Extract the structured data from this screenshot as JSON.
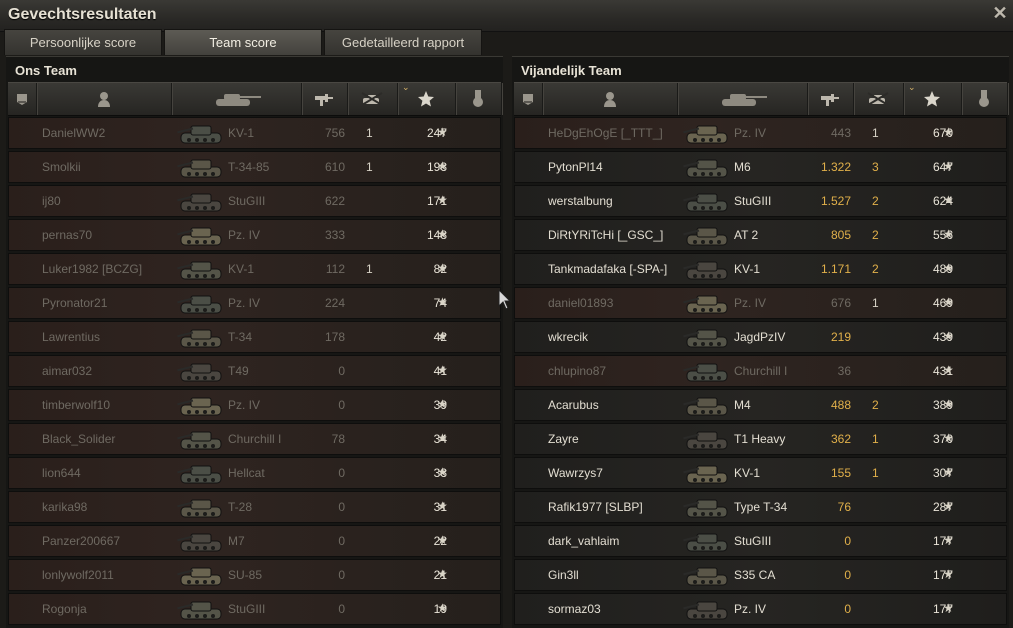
{
  "window": {
    "title": "Gevechtsresultaten",
    "close_glyph": "✕"
  },
  "tabs": [
    {
      "label": "Persoonlijke score",
      "active": false
    },
    {
      "label": "Team score",
      "active": true
    },
    {
      "label": "Gedetailleerd rapport",
      "active": false
    }
  ],
  "header_icons": [
    "squad-icon",
    "player-icon",
    "tank-icon",
    "damage-icon",
    "kills-icon",
    "xp-star-icon",
    "medal-icon"
  ],
  "star_glyph": "★",
  "colors": {
    "highlight_damage": "#e1b04a",
    "sort_indicator": "#d9b56a"
  },
  "teams": [
    {
      "title": "Ons Team",
      "rows": [
        {
          "player": "DanielWW2",
          "tank": "KV-1",
          "damage": "756",
          "kills": "1",
          "xp": "247",
          "dead": true,
          "bright": false
        },
        {
          "player": "Smolkii",
          "tank": "T-34-85",
          "damage": "610",
          "kills": "1",
          "xp": "193",
          "dead": true,
          "bright": false
        },
        {
          "player": "ij80",
          "tank": "StuGIII",
          "damage": "622",
          "kills": "",
          "xp": "171",
          "dead": true,
          "bright": false
        },
        {
          "player": "pernas70",
          "tank": "Pz. IV",
          "damage": "333",
          "kills": "",
          "xp": "148",
          "dead": true,
          "bright": false
        },
        {
          "player": "Luker1982 [BCZG]",
          "tank": "KV-1",
          "damage": "112",
          "kills": "1",
          "xp": "82",
          "dead": true,
          "bright": false
        },
        {
          "player": "Pyronator21",
          "tank": "Pz. IV",
          "damage": "224",
          "kills": "",
          "xp": "74",
          "dead": true,
          "bright": false
        },
        {
          "player": "Lawrentius",
          "tank": "T-34",
          "damage": "178",
          "kills": "",
          "xp": "42",
          "dead": true,
          "bright": false
        },
        {
          "player": "aimar032",
          "tank": "T49",
          "damage": "0",
          "kills": "",
          "xp": "41",
          "dead": true,
          "bright": false
        },
        {
          "player": "timberwolf10",
          "tank": "Pz. IV",
          "damage": "0",
          "kills": "",
          "xp": "39",
          "dead": true,
          "bright": false
        },
        {
          "player": "Black_Solider",
          "tank": "Churchill I",
          "damage": "78",
          "kills": "",
          "xp": "34",
          "dead": true,
          "bright": false
        },
        {
          "player": "lion644",
          "tank": "Hellcat",
          "damage": "0",
          "kills": "",
          "xp": "33",
          "dead": true,
          "bright": false
        },
        {
          "player": "karika98",
          "tank": "T-28",
          "damage": "0",
          "kills": "",
          "xp": "31",
          "dead": true,
          "bright": false
        },
        {
          "player": "Panzer200667",
          "tank": "M7",
          "damage": "0",
          "kills": "",
          "xp": "22",
          "dead": true,
          "bright": false
        },
        {
          "player": "lonlywolf2011",
          "tank": "SU-85",
          "damage": "0",
          "kills": "",
          "xp": "21",
          "dead": true,
          "bright": false
        },
        {
          "player": "Rogonja",
          "tank": "StuGIII",
          "damage": "0",
          "kills": "",
          "xp": "19",
          "dead": true,
          "bright": false
        }
      ]
    },
    {
      "title": "Vijandelijk Team",
      "rows": [
        {
          "player": "HeDgEhOgE [_TTT_]",
          "tank": "Pz. IV",
          "damage": "443",
          "kills": "1",
          "xp": "670",
          "dead": true,
          "bright": false
        },
        {
          "player": "PytonPl14",
          "tank": "M6",
          "damage": "1.322",
          "kills": "3",
          "xp": "647",
          "dead": false,
          "bright": true
        },
        {
          "player": "werstalbung",
          "tank": "StuGIII",
          "damage": "1.527",
          "kills": "2",
          "xp": "624",
          "dead": false,
          "bright": true
        },
        {
          "player": "DiRtYRiTcHi [_GSC_]",
          "tank": "AT 2",
          "damage": "805",
          "kills": "2",
          "xp": "556",
          "dead": false,
          "bright": true
        },
        {
          "player": "Tankmadafaka [-SPA-]",
          "tank": "KV-1",
          "damage": "1.171",
          "kills": "2",
          "xp": "489",
          "dead": false,
          "bright": true
        },
        {
          "player": "daniel01893",
          "tank": "Pz. IV",
          "damage": "676",
          "kills": "1",
          "xp": "469",
          "dead": true,
          "bright": false
        },
        {
          "player": "wkrecik",
          "tank": "JagdPzIV",
          "damage": "219",
          "kills": "",
          "xp": "439",
          "dead": false,
          "bright": true
        },
        {
          "player": "chlupino87",
          "tank": "Churchill I",
          "damage": "36",
          "kills": "",
          "xp": "431",
          "dead": true,
          "bright": false
        },
        {
          "player": "Acarubus",
          "tank": "M4",
          "damage": "488",
          "kills": "2",
          "xp": "389",
          "dead": false,
          "bright": true
        },
        {
          "player": "Zayre",
          "tank": "T1 Heavy",
          "damage": "362",
          "kills": "1",
          "xp": "370",
          "dead": false,
          "bright": true
        },
        {
          "player": "Wawrzys7",
          "tank": "KV-1",
          "damage": "155",
          "kills": "1",
          "xp": "307",
          "dead": false,
          "bright": true
        },
        {
          "player": "Rafik1977 [SLBP]",
          "tank": "Type T-34",
          "damage": "76",
          "kills": "",
          "xp": "287",
          "dead": false,
          "bright": true
        },
        {
          "player": "dark_vahlaim",
          "tank": "StuGIII",
          "damage": "0",
          "kills": "",
          "xp": "177",
          "dead": false,
          "bright": true
        },
        {
          "player": "Gin3ll",
          "tank": "S35 CA",
          "damage": "0",
          "kills": "",
          "xp": "177",
          "dead": false,
          "bright": true
        },
        {
          "player": "sormaz03",
          "tank": "Pz. IV",
          "damage": "0",
          "kills": "",
          "xp": "177",
          "dead": false,
          "bright": true
        }
      ]
    }
  ]
}
